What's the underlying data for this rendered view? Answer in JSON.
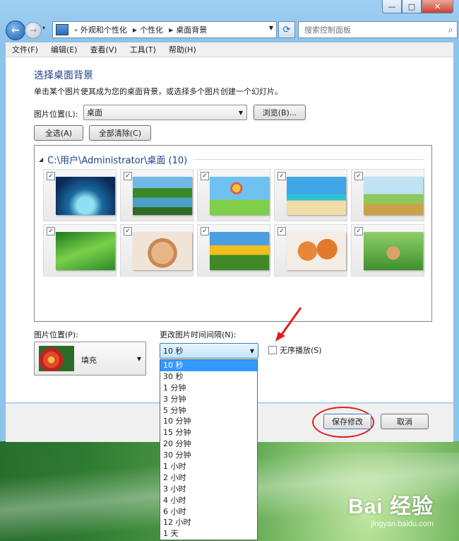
{
  "window": {
    "controls": {
      "minimize": "—",
      "maximize": "□",
      "close": "✕"
    }
  },
  "navbar": {
    "back_icon": "←",
    "forward_icon": "→",
    "history_icon": "▾",
    "address_prefix": "«",
    "breadcrumbs": [
      "外观和个性化",
      "个性化",
      "桌面背景"
    ],
    "search_placeholder": "搜索控制面板"
  },
  "menubar": {
    "items": [
      "文件(F)",
      "编辑(E)",
      "查看(V)",
      "工具(T)",
      "帮助(H)"
    ]
  },
  "main": {
    "title": "选择桌面背景",
    "subtitle": "单击某个图片使其成为您的桌面背景，或选择多个图片创建一个幻灯片。",
    "location_label": "图片位置(L):",
    "location_value": "桌面",
    "browse_button": "浏览(B)...",
    "select_all_button": "全选(A)",
    "clear_all_button": "全部清除(C)",
    "folder_header": "C:\\用户\\Administrator\\桌面 (10)",
    "thumbnails": [
      {
        "name": "tree-island",
        "checked": true
      },
      {
        "name": "lake-trees",
        "checked": true
      },
      {
        "name": "balloon-meadow",
        "checked": true
      },
      {
        "name": "beach-palm",
        "checked": true
      },
      {
        "name": "wheat-sky",
        "checked": true
      },
      {
        "name": "green-dew",
        "checked": true
      },
      {
        "name": "puppy",
        "checked": true
      },
      {
        "name": "sunflowers",
        "checked": true
      },
      {
        "name": "kittens",
        "checked": true
      },
      {
        "name": "hamster-rope",
        "checked": true
      }
    ],
    "position_label": "图片位置(P):",
    "position_value": "填充",
    "interval_label": "更改图片时间间隔(N):",
    "interval_value": "10 秒",
    "shuffle_label": "无序播放(S)",
    "shuffle_checked": false,
    "interval_options": [
      "10 秒",
      "30 秒",
      "1 分钟",
      "3 分钟",
      "5 分钟",
      "10 分钟",
      "15 分钟",
      "20 分钟",
      "30 分钟",
      "1 小时",
      "2 小时",
      "3 小时",
      "4 小时",
      "6 小时",
      "12 小时",
      "1 天"
    ],
    "interval_selected_index": 0
  },
  "footer": {
    "save_button": "保存修改",
    "cancel_button": "取消"
  },
  "watermark": {
    "main": "Bai 经验",
    "sub": "jingyan.baidu.com"
  },
  "colors": {
    "accent_title": "#1e3e8c",
    "selection": "#3399ff",
    "annotation": "#e02020"
  }
}
